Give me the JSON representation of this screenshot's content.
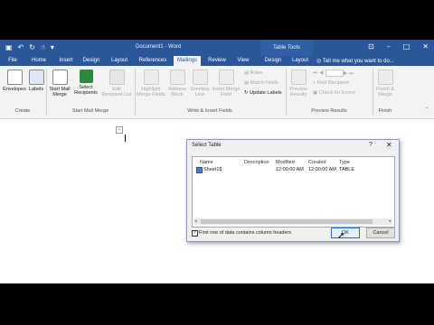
{
  "window": {
    "doc_title": "Document1 - Word",
    "context_title": "Table Tools",
    "tell_me": "Tell me what you want to do..."
  },
  "tabs": [
    "File",
    "Home",
    "Insert",
    "Design",
    "Layout",
    "References",
    "Mailings",
    "Review",
    "View",
    "Design",
    "Layout"
  ],
  "ribbon": {
    "create": {
      "envelopes": "Envelopes",
      "labels": "Labels",
      "group": "Create"
    },
    "start": {
      "start_mail_merge_1": "Start Mail",
      "start_mail_merge_2": "Merge",
      "select_recipients_1": "Select",
      "select_recipients_2": "Recipients",
      "edit_list_1": "Edit",
      "edit_list_2": "Recipient List",
      "group": "Start Mail Merge"
    },
    "write": {
      "highlight_1": "Highlight",
      "highlight_2": "Merge Fields",
      "address_1": "Address",
      "address_2": "Block",
      "greeting_1": "Greeting",
      "greeting_2": "Line",
      "insert_1": "Insert Merge",
      "insert_2": "Field",
      "rules": "Rules",
      "match": "Match Fields",
      "update": "Update Labels",
      "group": "Write & Insert Fields"
    },
    "preview": {
      "preview_1": "Preview",
      "preview_2": "Results",
      "find": "Find Recipient",
      "check": "Check for Errors",
      "group": "Preview Results"
    },
    "finish": {
      "finish_1": "Finish &",
      "finish_2": "Merge",
      "group": "Finish"
    }
  },
  "dialog": {
    "title": "Select Table",
    "help": "?",
    "columns": [
      "Name",
      "Description",
      "Modified",
      "Created",
      "Type"
    ],
    "rows": [
      {
        "name": "Sheet1$",
        "description": "",
        "modified": "12:00:00 AM",
        "created": "12:00:00 AM",
        "type": "TABLE"
      }
    ],
    "checkbox_label": "First row of data contains column headers",
    "checkbox_checked": true,
    "ok": "OK",
    "cancel": "Cancel"
  },
  "colors": {
    "title_bar": "#2b579a",
    "ribbon": "#f3f3f3",
    "dialog_border": "#7a9cd3"
  }
}
